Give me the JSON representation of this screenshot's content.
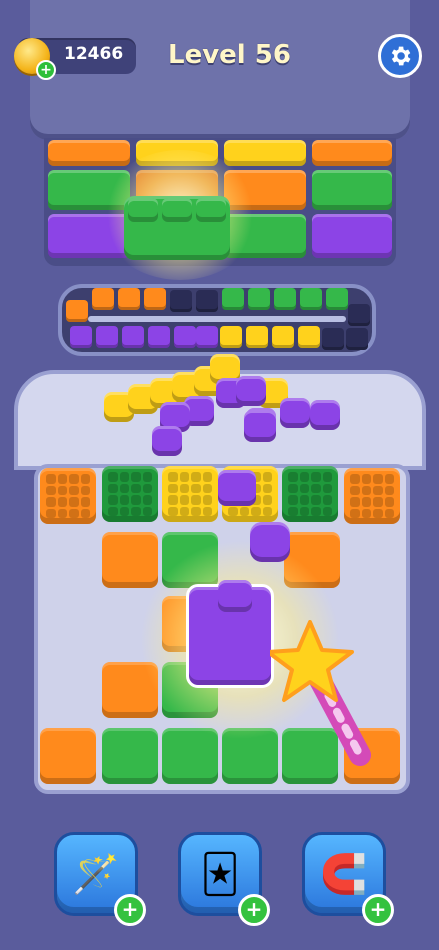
{
  "header": {
    "coins": "12466",
    "coin_plus": "+",
    "level_label": "Level 56"
  },
  "colors": {
    "orange": "#ff8a1c",
    "green": "#35b84a",
    "yellow": "#ffd21c",
    "purple": "#8c44e6",
    "background": "#5a5c9c"
  },
  "boosters": [
    {
      "name": "magic-wand",
      "icon": "wand-icon",
      "plus": "+"
    },
    {
      "name": "jester-hat",
      "icon": "jester-hat-icon",
      "plus": "+"
    },
    {
      "name": "magnet",
      "icon": "magnet-icon",
      "plus": "+"
    }
  ]
}
